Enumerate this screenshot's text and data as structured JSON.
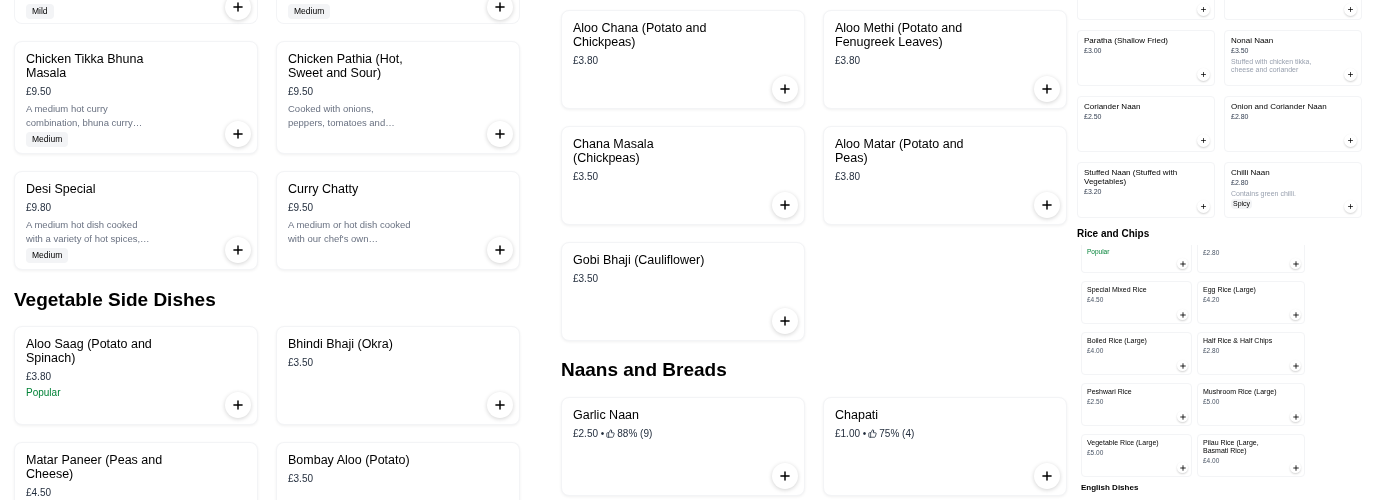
{
  "panels": [
    {
      "sections": [
        {
          "kind": "large",
          "items": [
            {
              "kind": "cut",
              "tags": [
                "Mild"
              ]
            },
            {
              "kind": "cut",
              "tags": [
                "Medium"
              ]
            },
            {
              "kind": "full",
              "name": "Chicken Tikka Bhuna Masala",
              "price": "£9.50",
              "description": "A medium hot curry combination, bhuna curry…",
              "tags": [
                "Medium"
              ]
            },
            {
              "kind": "full",
              "name": "Chicken Pathia (Hot, Sweet and Sour)",
              "price": "£9.50",
              "description": "Cooked with onions, peppers, tomatoes and…"
            },
            {
              "kind": "full",
              "name": "Desi Special",
              "price": "£9.80",
              "description": "A medium hot dish cooked with a variety of hot spices,…",
              "tags": [
                "Medium"
              ]
            },
            {
              "kind": "full",
              "name": "Curry Chatty",
              "price": "£9.50",
              "description": "A medium or hot dish cooked with our chef's own…"
            }
          ]
        },
        {
          "kind": "large",
          "heading": "Vegetable Side Dishes",
          "items": [
            {
              "kind": "full",
              "name": "Aloo Saag (Potato and Spinach)",
              "price": "£3.80",
              "popular": "Popular"
            },
            {
              "kind": "full",
              "name": "Bhindi Bhaji (Okra)",
              "price": "£3.50"
            },
            {
              "kind": "cut_bottom",
              "name": "Matar Paneer (Peas and Cheese)",
              "price": "£4.50"
            },
            {
              "kind": "cut_bottom",
              "name": "Bombay Aloo (Potato)",
              "price": "£3.50"
            }
          ]
        }
      ]
    },
    {
      "sections": [
        {
          "kind": "large",
          "items": [
            {
              "kind": "full",
              "name": "Aloo Chana (Potato and Chickpeas)",
              "price": "£3.80"
            },
            {
              "kind": "full",
              "name": "Aloo Methi (Potato and Fenugreek Leaves)",
              "price": "£3.80"
            },
            {
              "kind": "full",
              "name": "Chana Masala (Chickpeas)",
              "price": "£3.50"
            },
            {
              "kind": "full",
              "name": "Aloo Matar (Potato and Peas)",
              "price": "£3.80"
            },
            {
              "kind": "full",
              "name": "Gobi Bhaji (Cauliflower)",
              "price": "£3.50"
            }
          ]
        },
        {
          "kind": "large",
          "heading": "Naans and Breads",
          "items": [
            {
              "kind": "full",
              "name": "Garlic Naan",
              "price": "£2.50 •",
              "rating": "88% (9)"
            },
            {
              "kind": "full",
              "name": "Chapati",
              "price": "£1.00 •",
              "rating": "75% (4)"
            }
          ]
        }
      ]
    },
    {
      "sections": [
        {
          "kind": "compact",
          "items": [
            {
              "kind": "cut"
            },
            {
              "kind": "cut"
            },
            {
              "kind": "full",
              "name": "Paratha (Shallow Fried)",
              "price": "£3.00"
            },
            {
              "kind": "full",
              "name": "Nonai Naan",
              "price": "£3.50",
              "description": "Stuffed with chicken tikka, cheese and coriander"
            },
            {
              "kind": "full",
              "name": "Coriander Naan",
              "price": "£2.50"
            },
            {
              "kind": "full",
              "name": "Onion and Coriander Naan",
              "price": "£2.80"
            },
            {
              "kind": "full",
              "name": "Stuffed Naan (Stuffed with Vegetables)",
              "price": "£3.20"
            },
            {
              "kind": "full",
              "name": "Chilli Naan",
              "price": "£2.80",
              "description": "Contains green chilli.",
              "tags": [
                "Spicy"
              ]
            }
          ]
        },
        {
          "kind": "compact",
          "heading": "Rice and Chips"
        },
        {
          "kind": "mini",
          "items": [
            {
              "kind": "cut",
              "popular": "Popular"
            },
            {
              "kind": "cut",
              "price": "£2.80"
            },
            {
              "kind": "full",
              "name": "Special Mixed Rice",
              "price": "£4.50"
            },
            {
              "kind": "full",
              "name": "Egg Rice (Large)",
              "price": "£4.20"
            },
            {
              "kind": "full",
              "name": "Boiled Rice (Large)",
              "price": "£4.00"
            },
            {
              "kind": "full",
              "name": "Half Rice & Half Chips",
              "price": "£2.80"
            },
            {
              "kind": "full",
              "name": "Peshwari Rice",
              "price": "£2.50"
            },
            {
              "kind": "full",
              "name": "Mushroom Rice (Large)",
              "price": "£5.00"
            },
            {
              "kind": "full",
              "name": "Vegetable Rice (Large)",
              "price": "£5.00"
            },
            {
              "kind": "full",
              "name": "Pilau Rice (Large, Basmati Rice)",
              "price": "£4.00"
            }
          ]
        },
        {
          "kind": "mini",
          "heading": "English Dishes"
        }
      ]
    }
  ]
}
